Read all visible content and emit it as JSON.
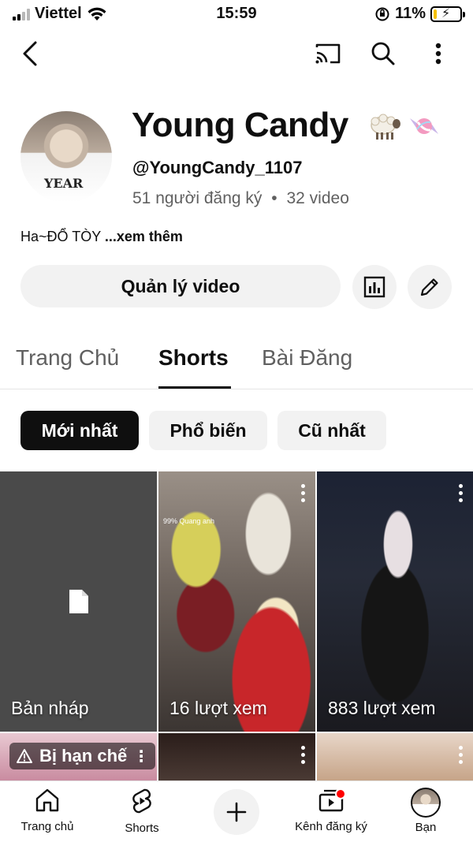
{
  "status_bar": {
    "carrier": "Viettel",
    "time": "15:59",
    "battery": "11%"
  },
  "top_bar": {
    "icons": [
      "back-icon",
      "cast-icon",
      "search-icon",
      "more-vert-icon"
    ]
  },
  "channel": {
    "name": "Young Candy",
    "name_emoji": "🐑🍬",
    "handle": "@YoungCandy_1107",
    "subscribers": "51 người đăng ký",
    "separator": "•",
    "video_count": "32 video",
    "description": "Ha~ĐỔ TÒY",
    "more_label": "...xem thêm",
    "avatar_shirt_text": "YEAR"
  },
  "actions": {
    "manage_label": "Quản lý video",
    "analytics_icon": "bar-chart-icon",
    "edit_icon": "pencil-icon"
  },
  "tabs": [
    {
      "label": "Trang Chủ",
      "active": false
    },
    {
      "label": "Shorts",
      "active": true
    },
    {
      "label": "Bài Đăng",
      "active": false
    }
  ],
  "chips": [
    {
      "label": "Mới nhất",
      "active": true
    },
    {
      "label": "Phổ biến",
      "active": false
    },
    {
      "label": "Cũ nhất",
      "active": false
    }
  ],
  "shorts": [
    {
      "label": "Bản nháp",
      "type": "draft"
    },
    {
      "label": "16 lượt xem",
      "overlay_text": "99%  Quang anh"
    },
    {
      "label": "883 lượt xem"
    },
    {
      "label": "Bị hạn chế",
      "restricted": true
    },
    {
      "label": ""
    },
    {
      "label": ""
    }
  ],
  "bottom_nav": [
    {
      "label": "Trang chủ",
      "icon": "home-icon"
    },
    {
      "label": "Shorts",
      "icon": "shorts-icon"
    },
    {
      "label": "",
      "icon": "create-icon"
    },
    {
      "label": "Kênh đăng ký",
      "icon": "subscriptions-icon"
    },
    {
      "label": "Bạn",
      "icon": "avatar-icon"
    }
  ],
  "colors": {
    "accent": "#0f0f0f",
    "chip_bg": "#f2f2f2",
    "notification": "#ff0000",
    "secondary_text": "#606060"
  }
}
